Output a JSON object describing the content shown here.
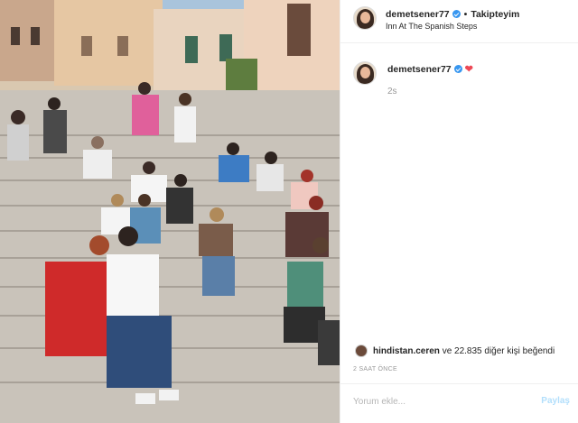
{
  "post": {
    "username": "demetsener77",
    "follow_status": "Takipteyim",
    "location": "Inn At The Spanish Steps",
    "photo_alt": "photo"
  },
  "caption": {
    "username": "demetsener77",
    "time_ago": "2s"
  },
  "likes": {
    "first_liker": "hindistan.ceren",
    "rest_text": "ve 22.835 diğer kişi beğendi"
  },
  "timestamp": "2 SAAT ÖNCE",
  "comment": {
    "placeholder": "Yorum ekle...",
    "post_label": "Paylaş"
  },
  "colors": {
    "verified": "#3897f0",
    "heart": "#ed4956",
    "post_button_disabled": "#b2dffc"
  },
  "icons": [
    "verified-badge-icon",
    "heart-icon"
  ]
}
